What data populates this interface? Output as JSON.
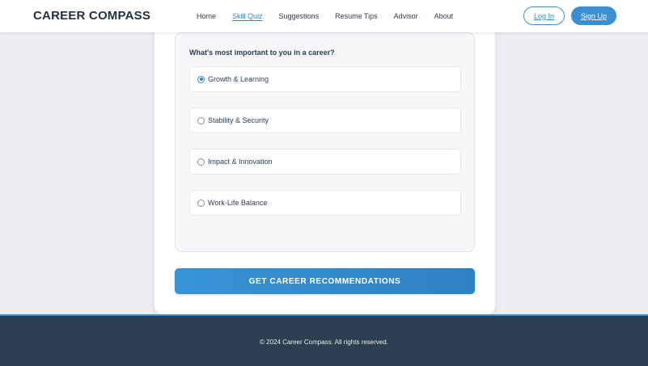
{
  "navbar": {
    "logo": "CAREER COMPASS",
    "links": [
      {
        "label": "Home",
        "active": false
      },
      {
        "label": "Skill Quiz",
        "active": true
      },
      {
        "label": "Suggestions",
        "active": false
      },
      {
        "label": "Resume Tips",
        "active": false
      },
      {
        "label": "Advisor",
        "active": false
      },
      {
        "label": "About",
        "active": false
      }
    ],
    "login_label": "Log In",
    "signup_label": "Sign Up"
  },
  "quiz": {
    "question": "What's most important to you in a career?",
    "options": [
      {
        "label": "Growth & Learning",
        "selected": true
      },
      {
        "label": "Stability & Security",
        "selected": false
      },
      {
        "label": "Impact & Innovation",
        "selected": false
      },
      {
        "label": "Work-Life Balance",
        "selected": false
      }
    ],
    "submit_label": "GET CAREER RECOMMENDATIONS"
  },
  "footer": {
    "copyright": "© 2024 Career Compass. All rights reserved."
  },
  "colors": {
    "accent": "#3a8fd3",
    "footer_bg": "#2c3e50",
    "page_bg": "#eceef1"
  }
}
